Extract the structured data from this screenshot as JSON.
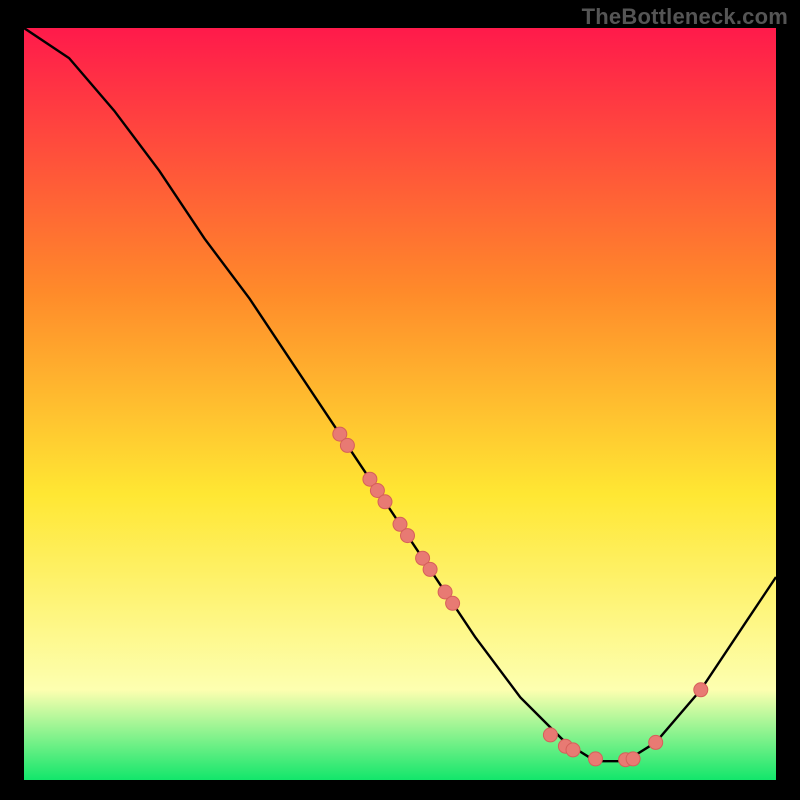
{
  "watermark": "TheBottleneck.com",
  "colors": {
    "frame": "#000000",
    "curve": "#000000",
    "marker_fill": "#e87a73",
    "marker_stroke": "#d65f5a",
    "gradient_top": "#ff1a4b",
    "gradient_mid1": "#ff8a2a",
    "gradient_mid2": "#ffe733",
    "gradient_mid3": "#fdffb0",
    "gradient_bottom": "#12e66b"
  },
  "chart_data": {
    "type": "line",
    "title": "",
    "xlabel": "",
    "ylabel": "",
    "x_range": [
      0,
      100
    ],
    "y_range": [
      0,
      100
    ],
    "curve": [
      {
        "x": 0,
        "y": 100
      },
      {
        "x": 6,
        "y": 96
      },
      {
        "x": 12,
        "y": 89
      },
      {
        "x": 18,
        "y": 81
      },
      {
        "x": 24,
        "y": 72
      },
      {
        "x": 30,
        "y": 64
      },
      {
        "x": 36,
        "y": 55
      },
      {
        "x": 42,
        "y": 46
      },
      {
        "x": 48,
        "y": 37
      },
      {
        "x": 54,
        "y": 28
      },
      {
        "x": 60,
        "y": 19
      },
      {
        "x": 66,
        "y": 11
      },
      {
        "x": 72,
        "y": 5
      },
      {
        "x": 76,
        "y": 2.5
      },
      {
        "x": 80,
        "y": 2.5
      },
      {
        "x": 84,
        "y": 5
      },
      {
        "x": 90,
        "y": 12
      },
      {
        "x": 96,
        "y": 21
      },
      {
        "x": 100,
        "y": 27
      }
    ],
    "markers": [
      {
        "x": 42,
        "y": 46
      },
      {
        "x": 43,
        "y": 44.5
      },
      {
        "x": 46,
        "y": 40
      },
      {
        "x": 47,
        "y": 38.5
      },
      {
        "x": 48,
        "y": 37
      },
      {
        "x": 50,
        "y": 34
      },
      {
        "x": 51,
        "y": 32.5
      },
      {
        "x": 53,
        "y": 29.5
      },
      {
        "x": 54,
        "y": 28
      },
      {
        "x": 56,
        "y": 25
      },
      {
        "x": 57,
        "y": 23.5
      },
      {
        "x": 70,
        "y": 6
      },
      {
        "x": 72,
        "y": 4.5
      },
      {
        "x": 73,
        "y": 4
      },
      {
        "x": 76,
        "y": 2.8
      },
      {
        "x": 80,
        "y": 2.7
      },
      {
        "x": 81,
        "y": 2.8
      },
      {
        "x": 84,
        "y": 5
      },
      {
        "x": 90,
        "y": 12
      }
    ],
    "marker_radius_px": 7
  }
}
